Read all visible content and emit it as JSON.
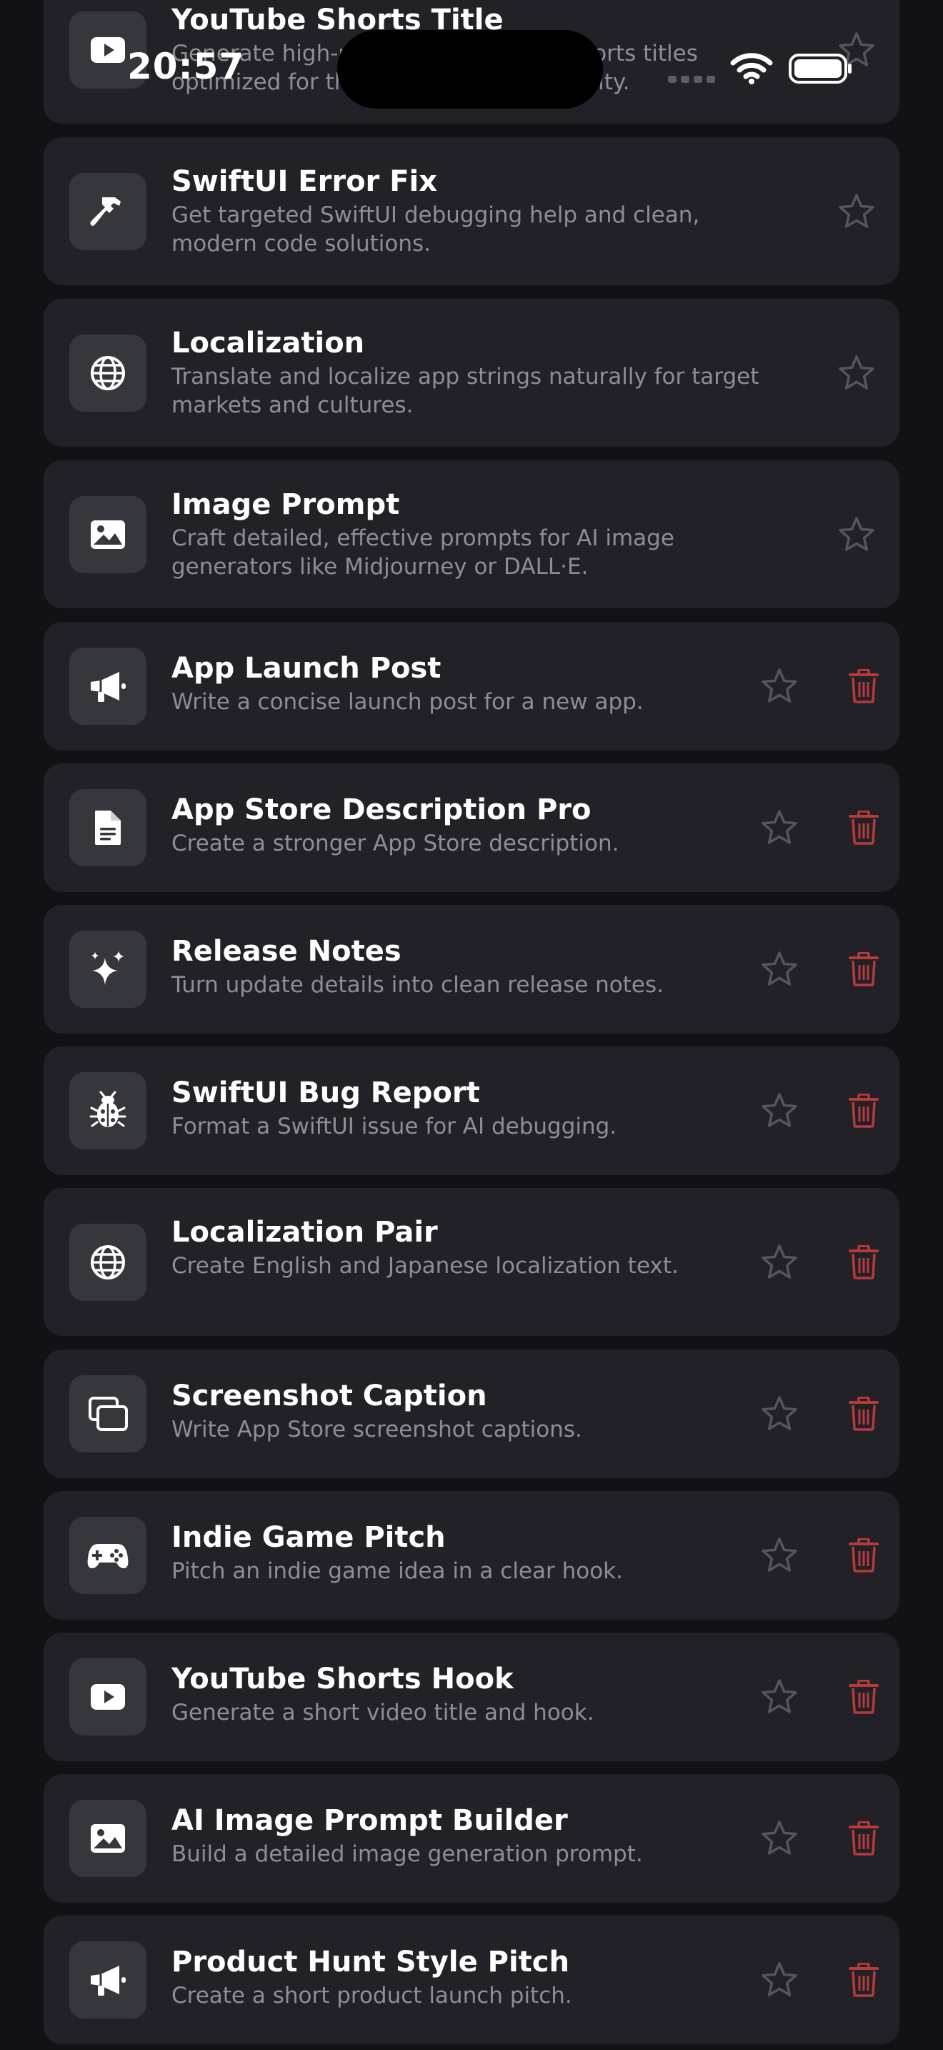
{
  "status_bar": {
    "time": "20:57"
  },
  "colors": {
    "background": "#121216",
    "card": "#212127",
    "icon_tile": "#36363d",
    "subtitle": "#8e8e96",
    "star": "#55555c",
    "delete": "#b63b3b"
  },
  "items": [
    {
      "title": "YouTube Shorts Title",
      "description": "Generate high-performing YouTube Shorts titles optimized for the algorithm and curiosity.",
      "icon": "play-rectangle-icon",
      "deletable": false
    },
    {
      "title": "SwiftUI Error Fix",
      "description": "Get targeted SwiftUI debugging help and clean, modern code solutions.",
      "icon": "hammer-icon",
      "deletable": false
    },
    {
      "title": "Localization",
      "description": "Translate and localize app strings naturally for target markets and cultures.",
      "icon": "globe-icon",
      "deletable": false
    },
    {
      "title": "Image Prompt",
      "description": "Craft detailed, effective prompts for AI image generators like Midjourney or DALL·E.",
      "icon": "photo-icon",
      "deletable": false
    },
    {
      "title": "App Launch Post",
      "description": "Write a concise launch post for a new app.",
      "icon": "megaphone-icon",
      "deletable": true
    },
    {
      "title": "App Store Description Pro",
      "description": "Create a stronger App Store description.",
      "icon": "document-icon",
      "deletable": true
    },
    {
      "title": "Release Notes",
      "description": "Turn update details into clean release notes.",
      "icon": "sparkles-icon",
      "deletable": true
    },
    {
      "title": "SwiftUI Bug Report",
      "description": "Format a SwiftUI issue for AI debugging.",
      "icon": "ladybug-icon",
      "deletable": true
    },
    {
      "title": "Localization Pair",
      "description": "Create English and Japanese localization text.",
      "icon": "globe-icon",
      "deletable": true
    },
    {
      "title": "Screenshot Caption",
      "description": "Write App Store screenshot captions.",
      "icon": "screenshot-stack-icon",
      "deletable": true
    },
    {
      "title": "Indie Game Pitch",
      "description": "Pitch an indie game idea in a clear hook.",
      "icon": "gamecontroller-icon",
      "deletable": true
    },
    {
      "title": "YouTube Shorts Hook",
      "description": "Generate a short video title and hook.",
      "icon": "play-rectangle-icon",
      "deletable": true
    },
    {
      "title": "AI Image Prompt Builder",
      "description": "Build a detailed image generation prompt.",
      "icon": "photo-icon",
      "deletable": true
    },
    {
      "title": "Product Hunt Style Pitch",
      "description": "Create a short product launch pitch.",
      "icon": "megaphone-icon",
      "deletable": true
    }
  ]
}
